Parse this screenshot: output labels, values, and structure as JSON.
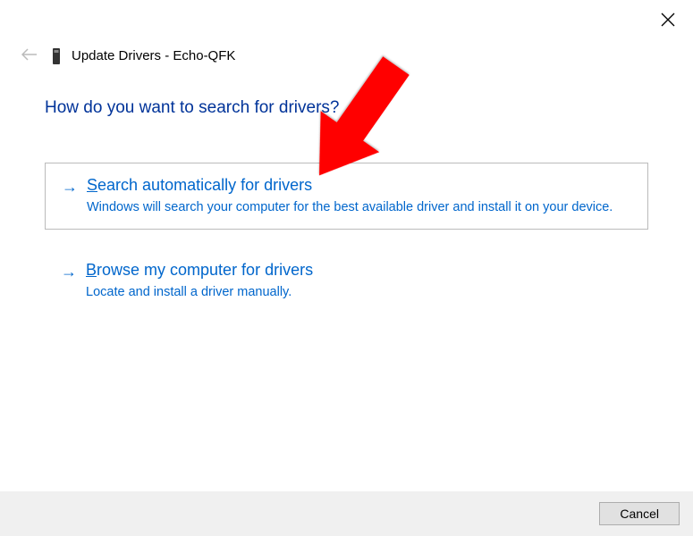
{
  "window": {
    "title_prefix": "Update Drivers - ",
    "title_device": "Echo-QFK"
  },
  "main": {
    "question": "How do you want to search for drivers?",
    "options": [
      {
        "title_pre": "S",
        "title_rest": "earch automatically for drivers",
        "description": "Windows will search your computer for the best available driver and install it on your device."
      },
      {
        "title_pre": "B",
        "title_rest": "rowse my computer for drivers",
        "description": "Locate and install a driver manually."
      }
    ]
  },
  "footer": {
    "cancel_label": "Cancel"
  },
  "annotation": {
    "arrow_color": "#ff0000"
  }
}
